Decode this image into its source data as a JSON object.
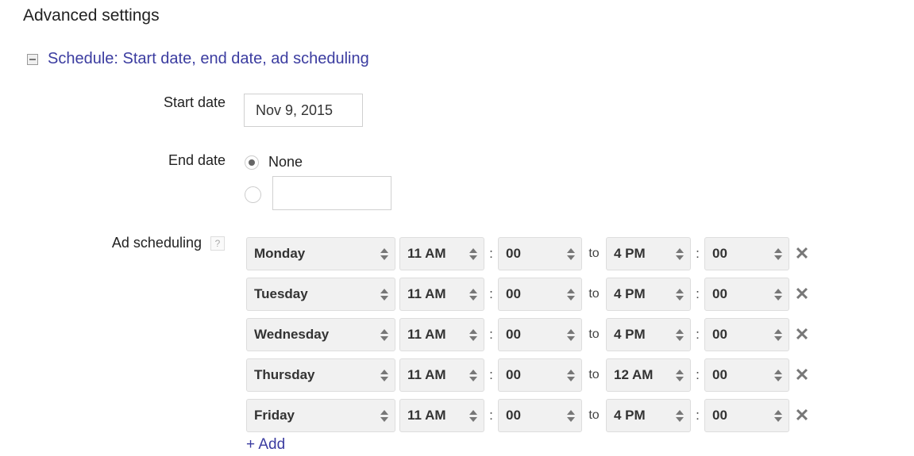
{
  "page_title": "Advanced settings",
  "section": {
    "label": "Schedule: Start date, end date, ad scheduling",
    "expanded": true
  },
  "start_date": {
    "label": "Start date",
    "value": "Nov 9, 2015"
  },
  "end_date": {
    "label": "End date",
    "option_none": "None",
    "selected": "none",
    "custom_value": ""
  },
  "ad_scheduling": {
    "label": "Ad scheduling",
    "help": "?",
    "to_label": "to",
    "colon": ":",
    "rows": [
      {
        "day": "Monday",
        "start_hour": "11 AM",
        "start_min": "00",
        "end_hour": "4 PM",
        "end_min": "00"
      },
      {
        "day": "Tuesday",
        "start_hour": "11 AM",
        "start_min": "00",
        "end_hour": "4 PM",
        "end_min": "00"
      },
      {
        "day": "Wednesday",
        "start_hour": "11 AM",
        "start_min": "00",
        "end_hour": "4 PM",
        "end_min": "00"
      },
      {
        "day": "Thursday",
        "start_hour": "11 AM",
        "start_min": "00",
        "end_hour": "12 AM",
        "end_min": "00"
      },
      {
        "day": "Friday",
        "start_hour": "11 AM",
        "start_min": "00",
        "end_hour": "4 PM",
        "end_min": "00"
      }
    ],
    "add_label": "+ Add",
    "remove_icon": "✕"
  }
}
